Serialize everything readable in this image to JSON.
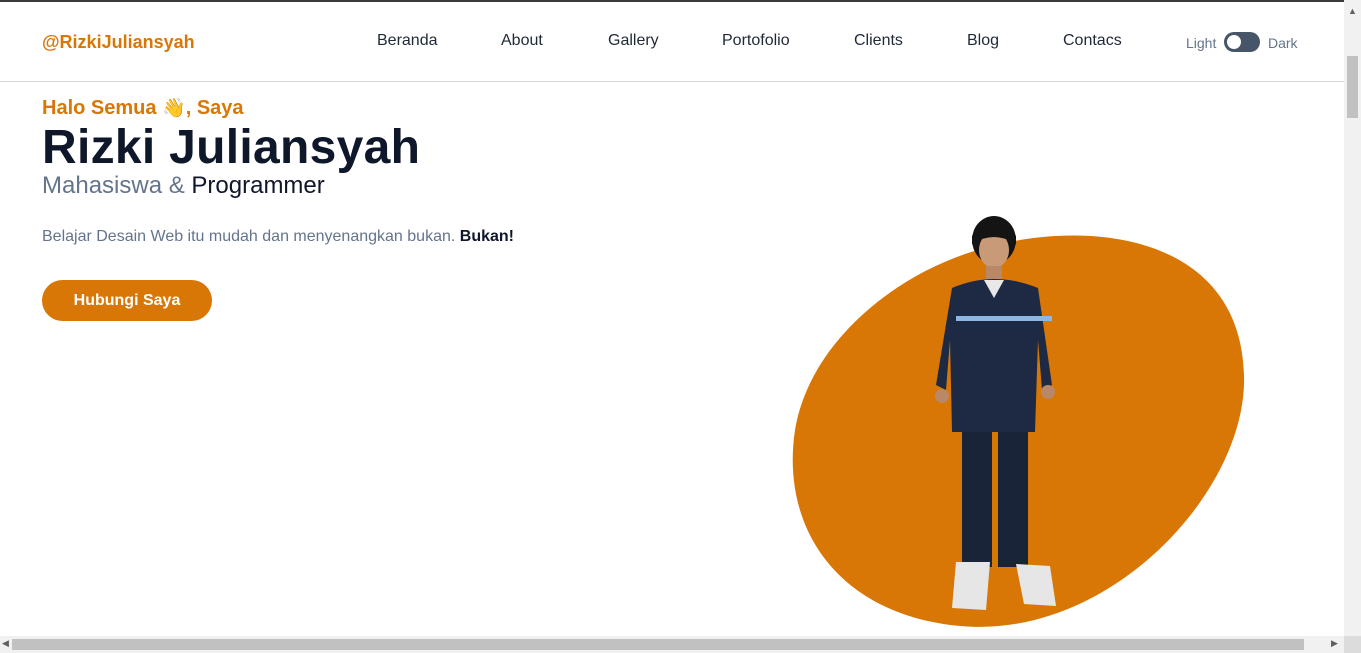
{
  "brand": {
    "name": "@RizkiJuliansyah",
    "color": "#d97706"
  },
  "nav": {
    "items": [
      {
        "label": "Beranda"
      },
      {
        "label": "About"
      },
      {
        "label": "Gallery"
      },
      {
        "label": "Portofolio"
      },
      {
        "label": "Clients"
      },
      {
        "label": "Blog"
      },
      {
        "label": "Contacs"
      }
    ]
  },
  "theme_toggle": {
    "light_label": "Light",
    "dark_label": "Dark",
    "state": "light"
  },
  "hero": {
    "greeting_prefix": "Halo Semua",
    "greeting_icon": "👋",
    "greeting_suffix": ", Saya",
    "name": "Rizki Juliansyah",
    "role_primary": "Mahasiswa &",
    "role_secondary": "Programmer",
    "tagline": "Belajar Desain Web itu mudah dan menyenangkan bukan.",
    "tagline_bold": "Bukan!",
    "cta_label": "Hubungi Saya",
    "accent_color": "#d97706"
  },
  "scrollbars": {
    "up_icon": "▲",
    "left_icon": "◀",
    "right_icon": "▶"
  }
}
